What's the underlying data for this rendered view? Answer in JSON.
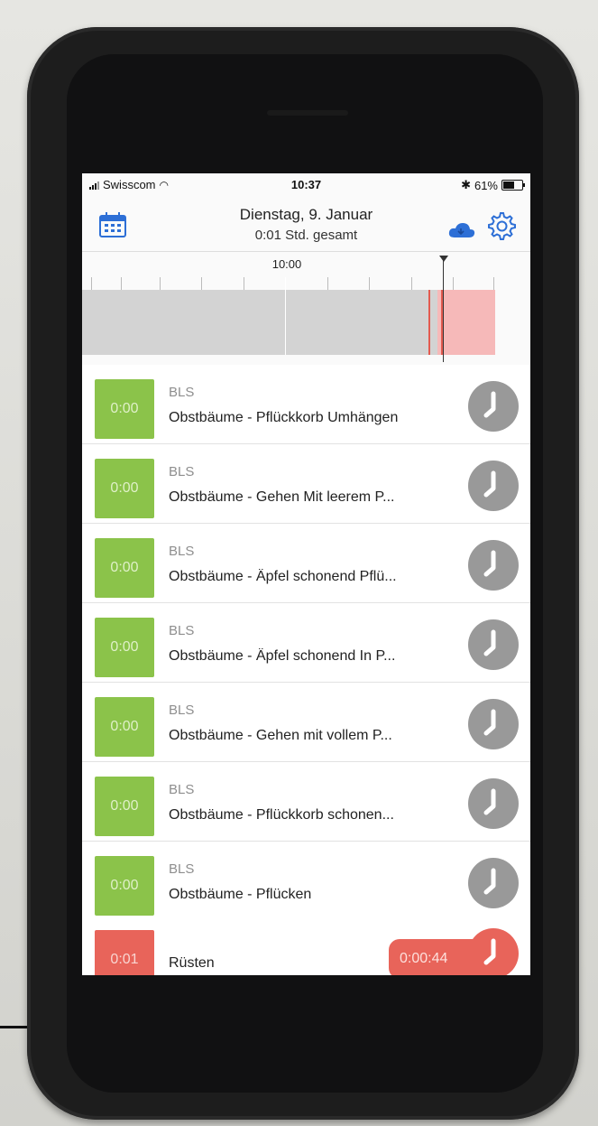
{
  "status_bar": {
    "carrier": "Swisscom",
    "time": "10:37",
    "battery": "61%",
    "battery_level": 0.61
  },
  "header": {
    "date": "Dienstag, 9. Januar",
    "total": "0:01 Std. gesamt"
  },
  "timeline": {
    "label": "10:00"
  },
  "tasks": [
    {
      "time": "0:00",
      "category": "BLS",
      "name": "Obstbäume - Pflückkorb Umhängen"
    },
    {
      "time": "0:00",
      "category": "BLS",
      "name": "Obstbäume - Gehen Mit leerem P..."
    },
    {
      "time": "0:00",
      "category": "BLS",
      "name": "Obstbäume - Äpfel schonend Pflü..."
    },
    {
      "time": "0:00",
      "category": "BLS",
      "name": "Obstbäume - Äpfel schonend In P..."
    },
    {
      "time": "0:00",
      "category": "BLS",
      "name": "Obstbäume - Gehen mit vollem P..."
    },
    {
      "time": "0:00",
      "category": "BLS",
      "name": "Obstbäume - Pflückkorb schonen..."
    },
    {
      "time": "0:00",
      "category": "BLS",
      "name": "Obstbäume - Pflücken"
    }
  ],
  "active_task": {
    "time": "0:01",
    "name": "Rüsten",
    "elapsed": "0:00:44"
  },
  "colors": {
    "green_tile": "#8bc34a",
    "active_red": "#e8645a",
    "clock_grey": "#999999",
    "accent_blue": "#2d6fd6"
  },
  "icons": [
    "calendar-icon",
    "cloud-icon",
    "gear-icon",
    "clock-icon",
    "wifi-icon",
    "bluetooth-icon",
    "battery-icon",
    "signal-icon"
  ]
}
